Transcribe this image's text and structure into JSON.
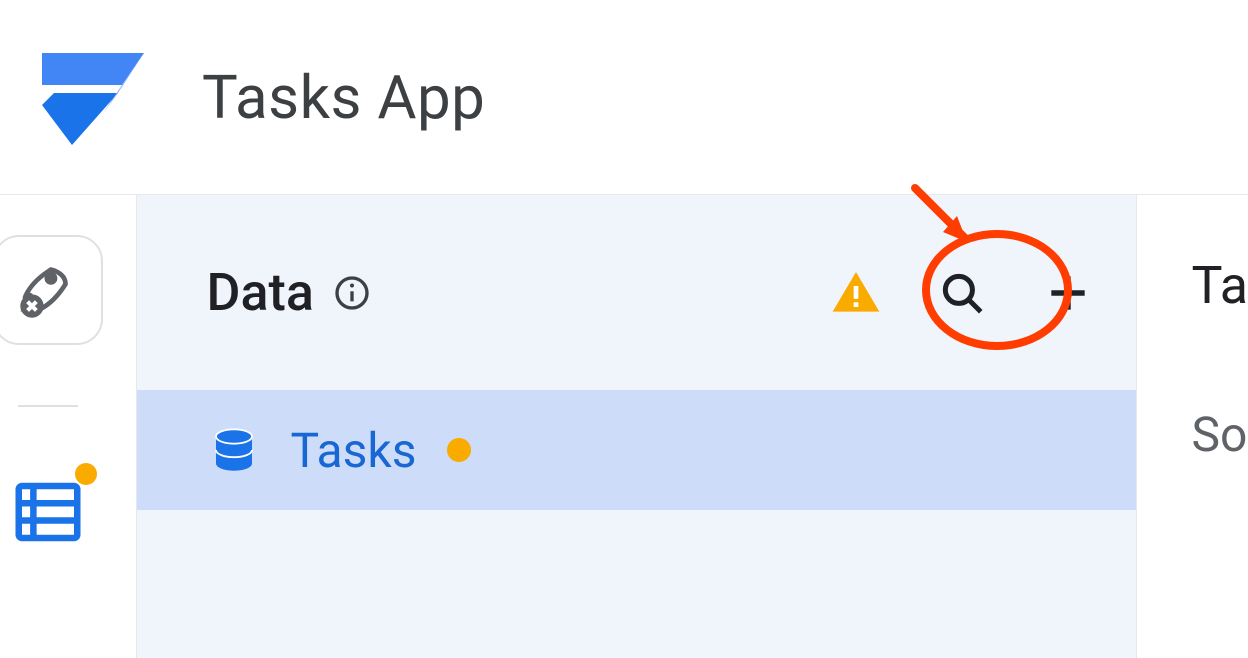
{
  "app": {
    "title": "Tasks App"
  },
  "rail": {
    "items": [
      {
        "name": "not-deployed",
        "icon": "rocket-x"
      },
      {
        "name": "data",
        "icon": "data",
        "active": true,
        "badge": true
      }
    ]
  },
  "data_panel": {
    "title": "Data",
    "actions": {
      "warning": "warning",
      "search": "search",
      "add": "add"
    },
    "sources": [
      {
        "label": "Tasks",
        "status": "pending"
      }
    ]
  },
  "right": {
    "title_fragment": "Ta",
    "sub_fragment": "So"
  },
  "annotation": {
    "target": "add-source-button"
  }
}
